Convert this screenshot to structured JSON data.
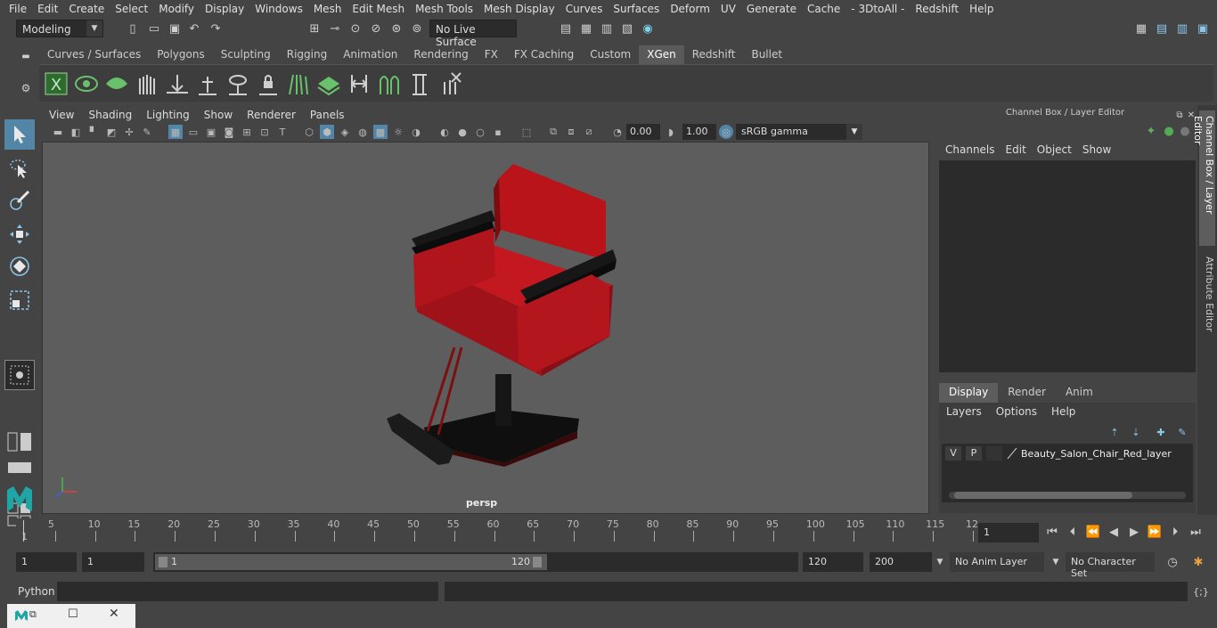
{
  "menubar": [
    "File",
    "Edit",
    "Create",
    "Select",
    "Modify",
    "Display",
    "Windows",
    "Mesh",
    "Edit Mesh",
    "Mesh Tools",
    "Mesh Display",
    "Curves",
    "Surfaces",
    "Deform",
    "UV",
    "Generate",
    "Cache",
    "- 3DtoAll -",
    "Redshift",
    "Help"
  ],
  "statusline": {
    "mode": "Modeling",
    "live_surface": "No Live Surface"
  },
  "shelf_tabs": [
    "Curves / Surfaces",
    "Polygons",
    "Sculpting",
    "Rigging",
    "Animation",
    "Rendering",
    "FX",
    "FX Caching",
    "Custom",
    "XGen",
    "Redshift",
    "Bullet"
  ],
  "shelf_active": "XGen",
  "viewport": {
    "menus": [
      "View",
      "Shading",
      "Lighting",
      "Show",
      "Renderer",
      "Panels"
    ],
    "exposure": "0.00",
    "gamma": "1.00",
    "color_space": "sRGB gamma",
    "camera_label": "persp"
  },
  "channel_box": {
    "title": "Channel Box / Layer Editor",
    "menus": [
      "Channels",
      "Edit",
      "Object",
      "Show"
    ]
  },
  "layer_editor": {
    "tabs": [
      "Display",
      "Render",
      "Anim"
    ],
    "active_tab": "Display",
    "menus": [
      "Layers",
      "Options",
      "Help"
    ],
    "layer": {
      "v": "V",
      "p": "P",
      "name": "Beauty_Salon_Chair_Red_layer"
    }
  },
  "side_tabs": [
    "Channel Box / Layer Editor",
    "Attribute Editor"
  ],
  "timeline": {
    "labels": [
      "5",
      "10",
      "15",
      "20",
      "25",
      "30",
      "35",
      "40",
      "45",
      "50",
      "55",
      "60",
      "65",
      "70",
      "75",
      "80",
      "85",
      "90",
      "95",
      "100",
      "105",
      "110",
      "115",
      "12"
    ],
    "start_marker": "1",
    "current_frame": "1"
  },
  "range": {
    "start": "1",
    "playback_start": "1",
    "slider_start": "1",
    "slider_end": "120",
    "playback_end": "120",
    "end": "200",
    "anim_layer": "No Anim Layer",
    "character_set": "No Character Set"
  },
  "cmdline": {
    "label": "Python"
  },
  "colors": {
    "accent": "#5285a6",
    "chair_red": "#c0171b",
    "viewport_bg": "#5d5d5d"
  }
}
